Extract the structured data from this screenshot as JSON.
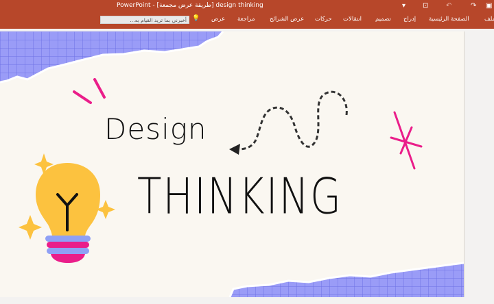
{
  "window": {
    "title": "PowerPoint - [طريقة عرض مجمعة] design thinking"
  },
  "quick_access": {
    "icons": [
      "present-icon",
      "save-icon",
      "undo-icon",
      "redo-icon",
      "customize-icon"
    ]
  },
  "ribbon": {
    "tabs": [
      {
        "label": "ملف"
      },
      {
        "label": "الصفحة الرئيسية"
      },
      {
        "label": "إدراج"
      },
      {
        "label": "تصميم"
      },
      {
        "label": "انتقالات"
      },
      {
        "label": "حركات"
      },
      {
        "label": "عرض الشرائح"
      },
      {
        "label": "مراجعة"
      },
      {
        "label": "عرض"
      }
    ],
    "search_placeholder": "أخبرني بما تريد القيام به..."
  },
  "slide": {
    "heading_line1": "Design",
    "heading_line2": "THINKING",
    "colors": {
      "background": "#faf7f1",
      "paper_blue": "#9a9cf7",
      "bulb_yellow": "#fcc23f",
      "accent_pink": "#ea1e8a",
      "band_blue": "#8fa0f5",
      "text": "#111111"
    }
  }
}
